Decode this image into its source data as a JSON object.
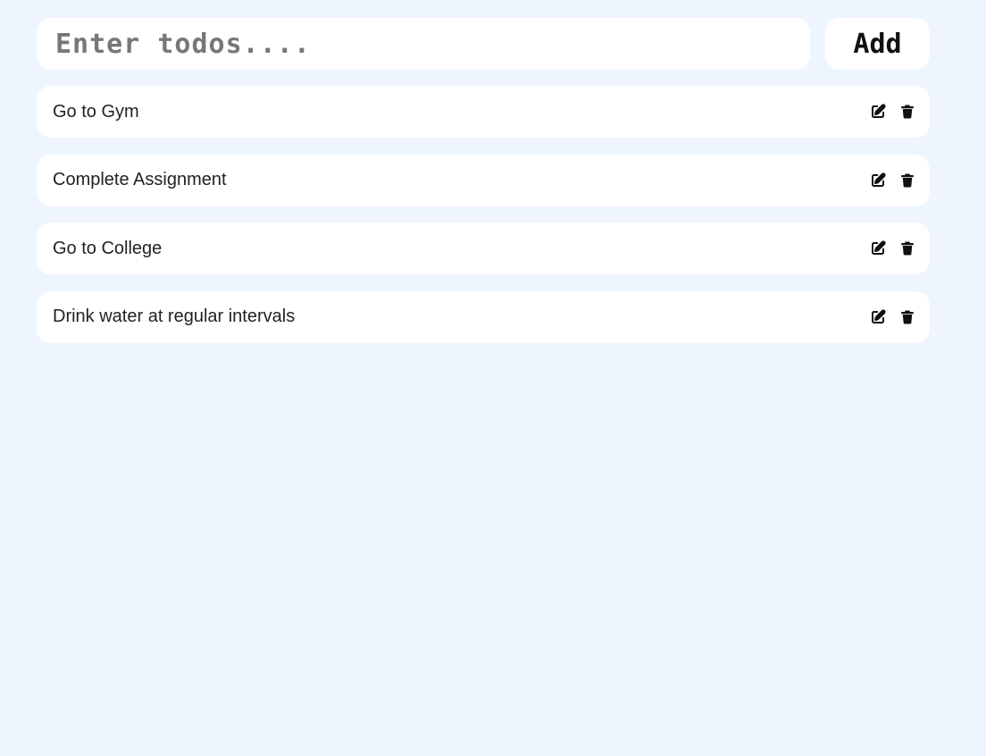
{
  "input": {
    "placeholder": "Enter todos....",
    "value": ""
  },
  "add_button": {
    "label": "Add"
  },
  "todos": [
    {
      "text": "Go to Gym",
      "edit_icon": "edit-icon",
      "delete_icon": "trash-icon"
    },
    {
      "text": "Complete Assignment",
      "edit_icon": "edit-icon",
      "delete_icon": "trash-icon"
    },
    {
      "text": "Go to College",
      "edit_icon": "edit-icon",
      "delete_icon": "trash-icon"
    },
    {
      "text": "Drink water at regular intervals",
      "edit_icon": "edit-icon",
      "delete_icon": "trash-icon"
    }
  ],
  "colors": {
    "background": "#eef5ff",
    "card": "#ffffff",
    "text": "#222222",
    "placeholder": "#777777"
  }
}
